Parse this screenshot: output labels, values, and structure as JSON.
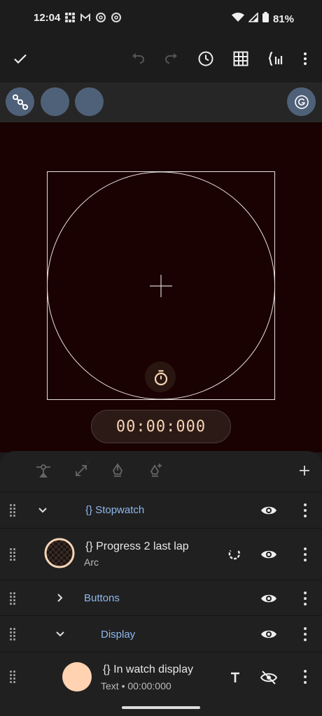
{
  "status_bar": {
    "time": "12:04",
    "battery": "81%",
    "notification_icons": [
      "grid-icon",
      "gmail-icon",
      "threads-icon",
      "threads-icon"
    ]
  },
  "toolbar": {
    "buttons": [
      "check-icon",
      "undo-icon",
      "redo-icon",
      "history-icon",
      "grid-icon",
      "code-icon",
      "more-icon"
    ]
  },
  "canvas": {
    "display_text": "00:00:000",
    "background": "#1a0202",
    "accent": "#f7d4b6"
  },
  "layers": [
    {
      "name": "{} Stopwatch",
      "type": "group",
      "expanded": true,
      "visible": true
    },
    {
      "name": "{} Progress 2 last lap",
      "subtitle": "Arc",
      "type": "arc",
      "visible": true
    },
    {
      "name": "Buttons",
      "type": "group",
      "expanded": false,
      "visible": true
    },
    {
      "name": "Display",
      "type": "group",
      "expanded": true,
      "visible": true
    },
    {
      "name": "{} In watch display",
      "subtitle": "Text • 00:00:000",
      "type": "text",
      "visible": false
    }
  ]
}
